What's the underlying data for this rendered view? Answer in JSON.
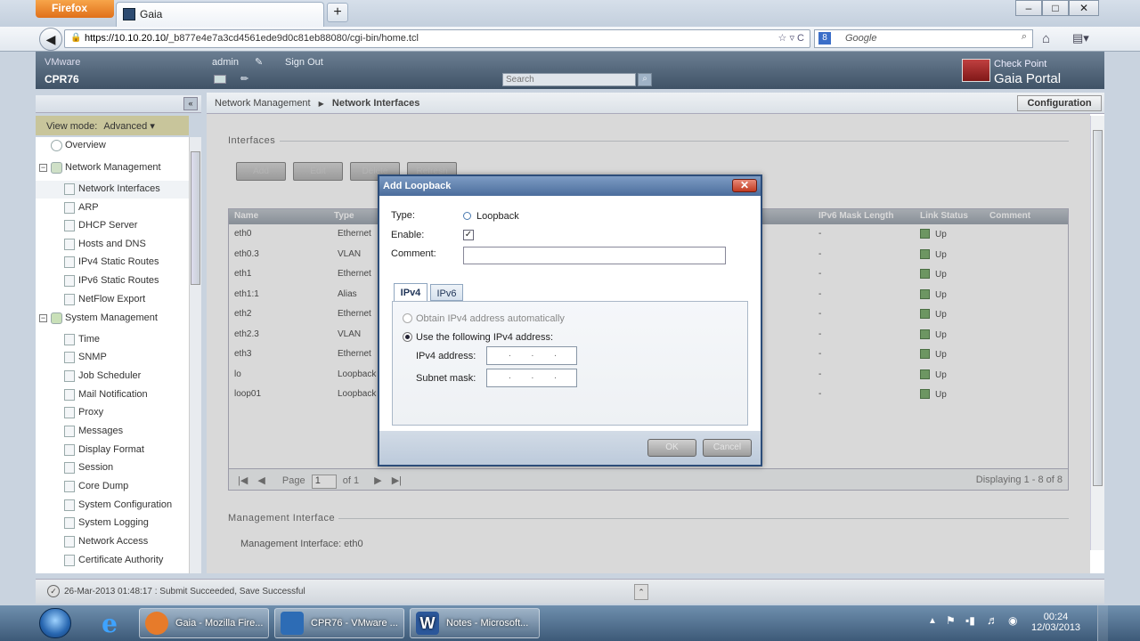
{
  "browser": {
    "firefox_label": "Firefox",
    "tab_title": "Gaia",
    "new_tab": "+",
    "url_host": "https://10.10.20.10/",
    "url_path": "_b877e4e7a3cd4561ede9d0c81eb88080/cgi-bin/home.tcl",
    "search_placeholder": "Google",
    "window_buttons": [
      "–",
      "□",
      "✕"
    ]
  },
  "header": {
    "vendor": "VMware",
    "hostname": "CPR76",
    "user": "admin",
    "sign_out": "Sign Out",
    "search_placeholder": "Search",
    "brand_line1": "Check Point",
    "brand_line2": "Gaia Portal"
  },
  "sidebar": {
    "view_mode_label": "View mode:",
    "view_mode_value": "Advanced",
    "items": [
      {
        "label": "Overview"
      },
      {
        "label": "Network Management"
      },
      {
        "label": "Network Interfaces"
      },
      {
        "label": "ARP"
      },
      {
        "label": "DHCP Server"
      },
      {
        "label": "Hosts and DNS"
      },
      {
        "label": "IPv4 Static Routes"
      },
      {
        "label": "IPv6 Static Routes"
      },
      {
        "label": "NetFlow Export"
      },
      {
        "label": "System Management"
      },
      {
        "label": "Time"
      },
      {
        "label": "SNMP"
      },
      {
        "label": "Job Scheduler"
      },
      {
        "label": "Mail Notification"
      },
      {
        "label": "Proxy"
      },
      {
        "label": "Messages"
      },
      {
        "label": "Display Format"
      },
      {
        "label": "Session"
      },
      {
        "label": "Core Dump"
      },
      {
        "label": "System Configuration"
      },
      {
        "label": "System Logging"
      },
      {
        "label": "Network Access"
      },
      {
        "label": "Certificate Authority"
      }
    ]
  },
  "main": {
    "breadcrumb_parent": "Network Management",
    "breadcrumb_current": "Network Interfaces",
    "configuration": "Configuration",
    "interfaces_section": "Interfaces",
    "toolbar": [
      "Add",
      "Edit",
      "Delete",
      "Refresh"
    ],
    "columns": [
      "Name",
      "Type",
      "IPv6 Mask Length",
      "Link Status",
      "Comment"
    ],
    "rows": [
      {
        "name": "eth0",
        "type": "Ethernet",
        "ipv6mask": "-",
        "link": "Up"
      },
      {
        "name": "eth0.3",
        "type": "VLAN",
        "ipv6mask": "-",
        "link": "Up"
      },
      {
        "name": "eth1",
        "type": "Ethernet",
        "ipv6mask": "-",
        "link": "Up"
      },
      {
        "name": "eth1:1",
        "type": "Alias",
        "ipv6mask": "-",
        "link": "Up"
      },
      {
        "name": "eth2",
        "type": "Ethernet",
        "ipv6mask": "-",
        "link": "Up"
      },
      {
        "name": "eth2.3",
        "type": "VLAN",
        "ipv6mask": "-",
        "link": "Up"
      },
      {
        "name": "eth3",
        "type": "Ethernet",
        "ipv6mask": "-",
        "link": "Up"
      },
      {
        "name": "lo",
        "type": "Loopback",
        "ipv6mask": "-",
        "link": "Up"
      },
      {
        "name": "loop01",
        "type": "Loopback",
        "ipv6mask": "-",
        "link": "Up"
      }
    ],
    "pager": {
      "page_label": "Page",
      "page_value": "1",
      "of_label": "of 1",
      "displaying": "Displaying 1 - 8 of 8"
    },
    "mgmt_section": "Management Interface",
    "mgmt_value": "Management Interface: eth0"
  },
  "dialog": {
    "title": "Add Loopback",
    "close": "✕",
    "type_label": "Type:",
    "type_value": "Loopback",
    "enable_label": "Enable:",
    "enable_checked": "✓",
    "comment_label": "Comment:",
    "comment_value": "",
    "tab_ipv4": "IPv4",
    "tab_ipv6": "IPv6",
    "radio_auto": "Obtain IPv4 address automatically",
    "radio_manual": "Use the following IPv4 address:",
    "ipv4_label": "IPv4 address:",
    "mask_label": "Subnet mask:",
    "ip_placeholder": ". . .",
    "ok": "OK",
    "cancel": "Cancel"
  },
  "status": {
    "message": "26-Mar-2013 01:48:17 : Submit Succeeded, Save Successful"
  },
  "taskbar": {
    "items": [
      {
        "label": "Gaia - Mozilla Fire...",
        "color": "#e77b2a"
      },
      {
        "label": "CPR76 - VMware ...",
        "color": "#2d6cb5"
      },
      {
        "label": "Notes - Microsoft...",
        "color": "#2b579a"
      }
    ],
    "time": "00:24",
    "date": "12/03/2013"
  }
}
